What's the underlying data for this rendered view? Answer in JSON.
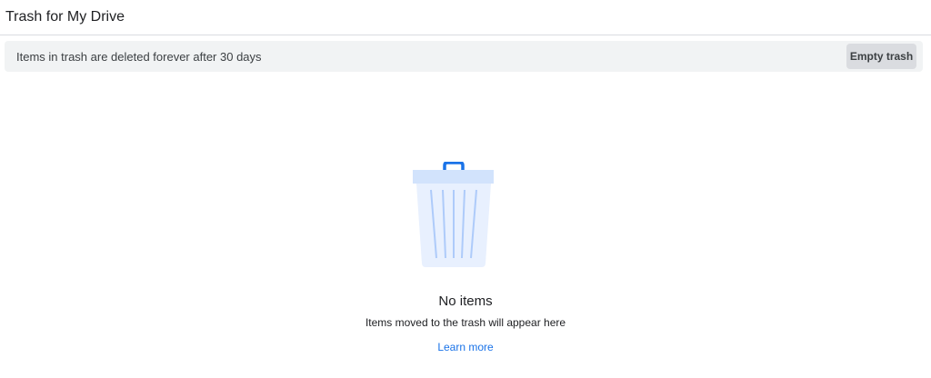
{
  "header": {
    "title": "Trash for My Drive"
  },
  "banner": {
    "message": "Items in trash are deleted forever after 30 days",
    "empty_trash_label": "Empty trash"
  },
  "empty_state": {
    "icon": "trash-can-icon",
    "title": "No items",
    "subtitle": "Items moved to the trash will appear here",
    "link_label": "Learn more"
  },
  "colors": {
    "accent": "#1a73e8",
    "banner_bg": "#f1f3f4",
    "button_bg": "#dadce0",
    "trash_body": "#e8f0fe",
    "trash_lines": "#aecbfa"
  }
}
